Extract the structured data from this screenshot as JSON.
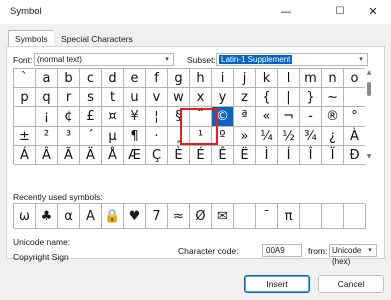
{
  "window": {
    "title": "Symbol",
    "minimize": "—",
    "maximize": "☐",
    "close": "✕"
  },
  "tabs": [
    {
      "label": "Symbols",
      "active": true
    },
    {
      "label": "Special Characters",
      "active": false
    }
  ],
  "font": {
    "label": "Font:",
    "value": "(normal text)"
  },
  "subset": {
    "label": "Subset:",
    "value": "Latin-1 Supplement"
  },
  "grid": [
    [
      "`",
      "a",
      "b",
      "c",
      "d",
      "e",
      "f",
      "g",
      "h",
      "i",
      "j",
      "k",
      "l",
      "m",
      "n",
      "o"
    ],
    [
      "p",
      "q",
      "r",
      "s",
      "t",
      "u",
      "v",
      "w",
      "x",
      "y",
      "z",
      "{",
      "|",
      "}",
      "~",
      ""
    ],
    [
      "",
      "¡",
      "¢",
      "£",
      "¤",
      "¥",
      "¦",
      "§",
      "¨",
      "©",
      "ª",
      "«",
      "¬",
      "-",
      "®",
      "¯"
    ],
    [
      "°",
      "±",
      "²",
      "³",
      "´",
      "µ",
      "¶",
      "·",
      "¸",
      "¹",
      "º",
      "»",
      "¼",
      "½",
      "¾",
      "¿"
    ],
    [
      "À",
      "Á",
      "Â",
      "Ã",
      "Ä",
      "Å",
      "Æ",
      "Ç",
      "È",
      "É",
      "Ê",
      "Ë",
      "Ì",
      "Í",
      "Î",
      "Ï"
    ]
  ],
  "grid_visible": [
    [
      "`",
      "a",
      "b",
      "c",
      "d",
      "e",
      "f",
      "g",
      "h",
      "i",
      "j",
      "k",
      "l",
      "m",
      "n",
      "o"
    ],
    [
      "p",
      "q",
      "r",
      "s",
      "t",
      "u",
      "v",
      "w",
      "x",
      "y",
      "z",
      "{",
      "|",
      "}",
      "~",
      ""
    ],
    [
      "",
      "¡",
      "¢",
      "£",
      "¤",
      "¥",
      "¦",
      "§",
      "¨",
      "©",
      "ª",
      "«",
      "¬",
      "-",
      "®",
      "°"
    ],
    [
      "±",
      "²",
      "³",
      "´",
      "µ",
      "¶",
      "·",
      "¸",
      "¹",
      "º",
      "»",
      "¼",
      "½",
      "¾",
      "¿",
      "À"
    ],
    [
      "Á",
      "Â",
      "Ã",
      "Ä",
      "Å",
      "Æ",
      "Ç",
      "È",
      "É",
      "Ê",
      "Ë",
      "Ì",
      "Í",
      "Î",
      "Ï",
      "Ð"
    ]
  ],
  "selected": {
    "row": 2,
    "col": 9
  },
  "recent": {
    "label": "Recently used symbols:",
    "symbols": [
      "ω",
      "♣",
      "α",
      "Α",
      "🔒",
      "♥",
      "7",
      "≈",
      "Ø",
      "✉",
      "",
      "¯",
      "π"
    ]
  },
  "unicode_name": {
    "label": "Unicode name:",
    "value": "Copyright Sign"
  },
  "char_code": {
    "label": "Character code:",
    "value": "00A9"
  },
  "from": {
    "label": "from:",
    "value": "Unicode (hex)"
  },
  "buttons": {
    "insert": "Insert",
    "cancel": "Cancel"
  }
}
